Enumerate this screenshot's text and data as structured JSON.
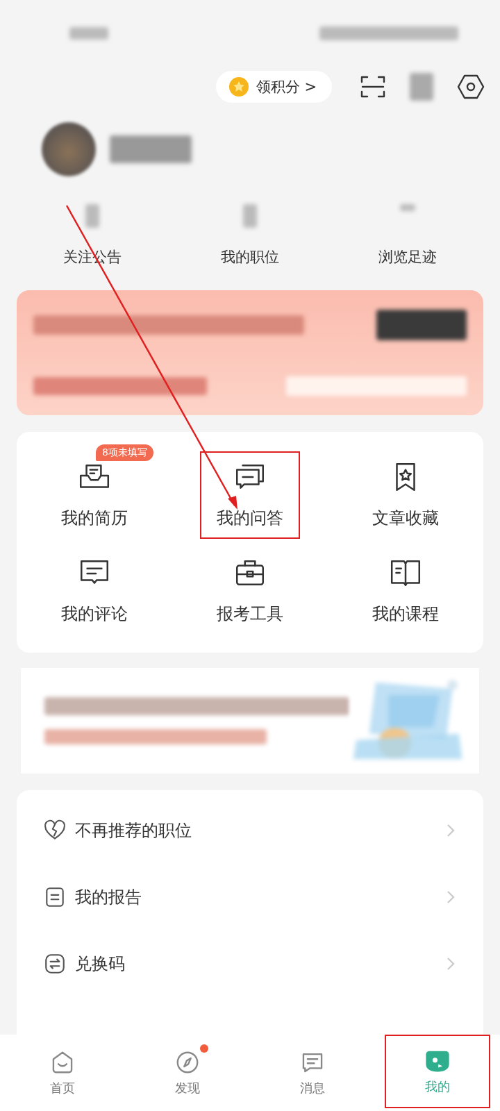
{
  "header": {
    "points_button": "领积分 >"
  },
  "stats": [
    {
      "label": "关注公告"
    },
    {
      "label": "我的职位"
    },
    {
      "label": "浏览足迹"
    }
  ],
  "grid": [
    {
      "kind": "resume",
      "label": "我的简历",
      "badge": "8项未填写",
      "highlighted": false
    },
    {
      "kind": "qa",
      "label": "我的问答",
      "highlighted": true
    },
    {
      "kind": "bookmark",
      "label": "文章收藏",
      "highlighted": false
    },
    {
      "kind": "comment",
      "label": "我的评论",
      "highlighted": false
    },
    {
      "kind": "toolbox",
      "label": "报考工具",
      "highlighted": false
    },
    {
      "kind": "book",
      "label": "我的课程",
      "highlighted": false
    }
  ],
  "list": [
    {
      "kind": "heart",
      "label": "不再推荐的职位"
    },
    {
      "kind": "report",
      "label": "我的报告"
    },
    {
      "kind": "exchange",
      "label": "兑换码"
    }
  ],
  "tabs": [
    {
      "kind": "home",
      "label": "首页",
      "selected": false,
      "dot": false,
      "highlighted": false
    },
    {
      "kind": "compass",
      "label": "发现",
      "selected": false,
      "dot": true,
      "highlighted": false
    },
    {
      "kind": "message",
      "label": "消息",
      "selected": false,
      "dot": false,
      "highlighted": false
    },
    {
      "kind": "me",
      "label": "我的",
      "selected": true,
      "dot": false,
      "highlighted": true
    }
  ]
}
